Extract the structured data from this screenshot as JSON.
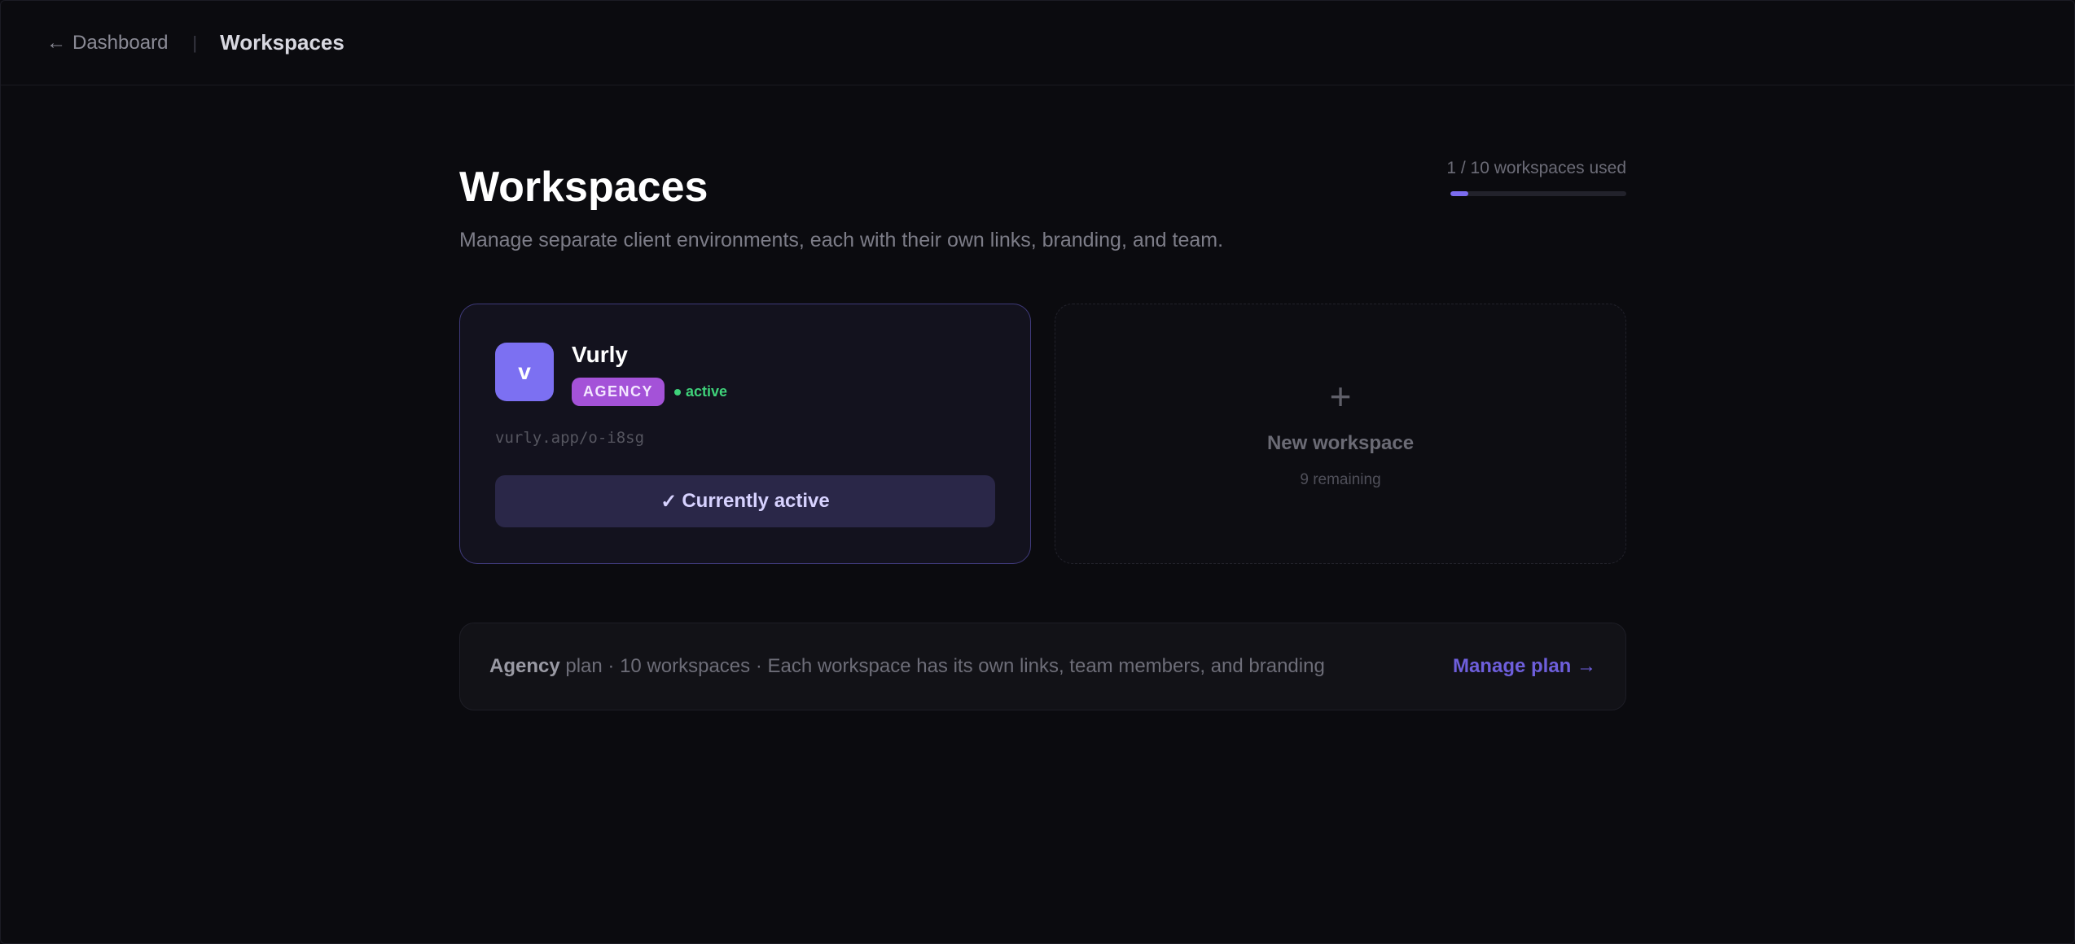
{
  "topbar": {
    "back_arrow": "←",
    "back_label": "Dashboard",
    "separator": "|",
    "current": "Workspaces"
  },
  "header": {
    "title": "Workspaces",
    "subtitle": "Manage separate client environments, each with their own links, branding, and team.",
    "usage_text": "1 / 10 workspaces used",
    "usage_fraction": 0.1
  },
  "workspaces": [
    {
      "avatar_letter": "v",
      "name": "Vurly",
      "plan_badge": "AGENCY",
      "status": "active",
      "url": "vurly.app/o-i8sg",
      "button_check": "✓",
      "button_label": "Currently active"
    }
  ],
  "new_workspace": {
    "icon": "+",
    "label": "New workspace",
    "remaining": "9 remaining"
  },
  "plan_bar": {
    "plan_name": "Agency",
    "details": " plan · 10 workspaces · Each workspace has its own links, team members, and branding",
    "manage_label": "Manage plan →"
  },
  "colors": {
    "accent": "#7c6cf0",
    "badge": "#a452d8",
    "status_active": "#3fd27a",
    "link": "#6e5fdc"
  }
}
